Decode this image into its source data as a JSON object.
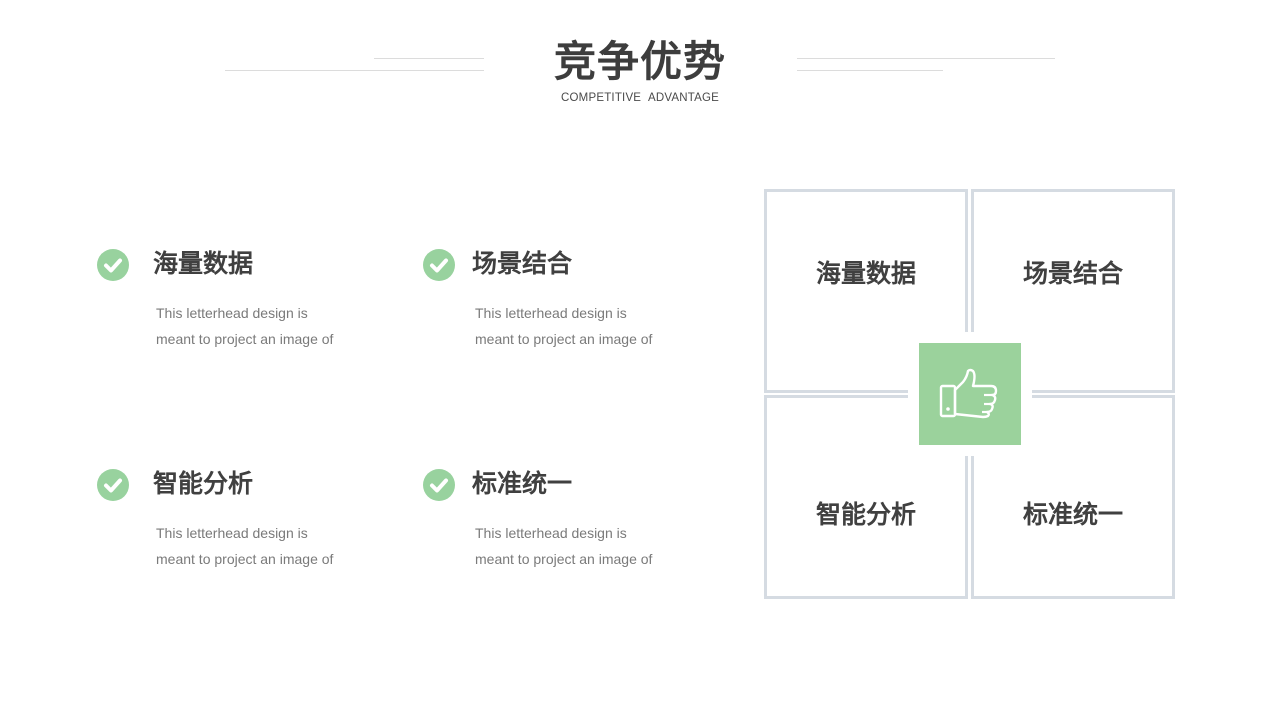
{
  "header": {
    "title": "竞争优势",
    "subtitle": "COMPETITIVE  ADVANTAGE"
  },
  "features": [
    {
      "title": "海量数据",
      "desc_line1": "This letterhead design is",
      "desc_line2": "meant to project an image of",
      "icon": "check-circle-icon"
    },
    {
      "title": "场景结合",
      "desc_line1": "This letterhead design is",
      "desc_line2": "meant to project an image of",
      "icon": "check-circle-icon"
    },
    {
      "title": "智能分析",
      "desc_line1": "This letterhead design is",
      "desc_line2": "meant to project an image of",
      "icon": "check-circle-icon"
    },
    {
      "title": "标准统一",
      "desc_line1": "This letterhead design is",
      "desc_line2": "meant to project an image of",
      "icon": "check-circle-icon"
    }
  ],
  "diagram": {
    "quadrants": [
      "海量数据",
      "场景结合",
      "智能分析",
      "标准统一"
    ],
    "center_icon": "thumbs-up-icon"
  },
  "colors": {
    "accent_green": "#98d29e",
    "center_green": "#9bd29c",
    "border_gray": "#d5dbe2",
    "text_dark": "#404040",
    "text_muted": "#7a7a7a"
  }
}
